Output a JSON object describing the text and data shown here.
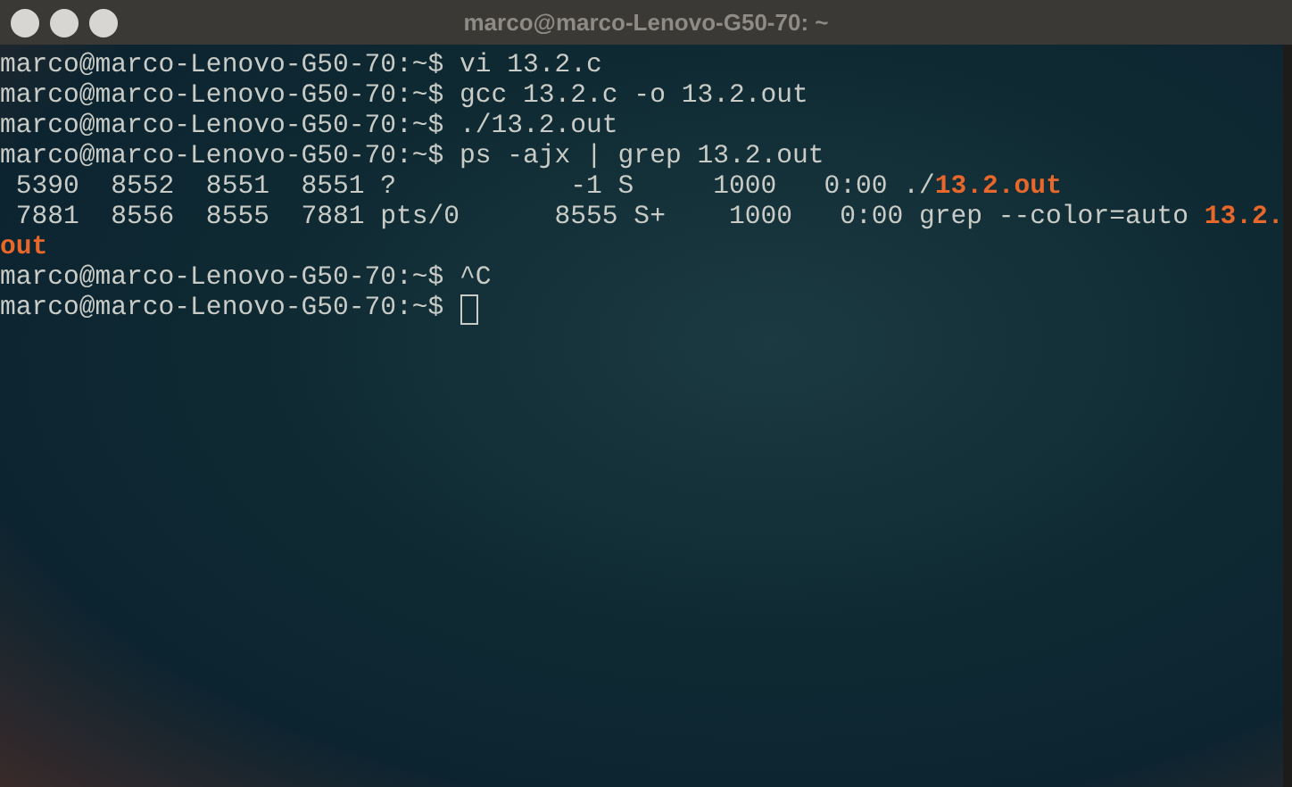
{
  "window": {
    "title": "marco@marco-Lenovo-G50-70: ~"
  },
  "terminal": {
    "cursor": true,
    "lines": [
      {
        "segments": [
          {
            "text": "marco@marco-Lenovo-G50-70:~$ vi 13.2.c",
            "highlight": false
          }
        ]
      },
      {
        "segments": [
          {
            "text": "marco@marco-Lenovo-G50-70:~$ gcc 13.2.c -o 13.2.out",
            "highlight": false
          }
        ]
      },
      {
        "segments": [
          {
            "text": "marco@marco-Lenovo-G50-70:~$ ./13.2.out",
            "highlight": false
          }
        ]
      },
      {
        "segments": [
          {
            "text": "marco@marco-Lenovo-G50-70:~$ ps -ajx | grep 13.2.out",
            "highlight": false
          }
        ]
      },
      {
        "segments": [
          {
            "text": " 5390  8552  8551  8551 ?           -1 S     1000   0:00 ./",
            "highlight": false
          },
          {
            "text": "13.2.out",
            "highlight": true
          }
        ]
      },
      {
        "segments": [
          {
            "text": " 7881  8556  8555  7881 pts/0      8555 S+    1000   0:00 grep --color=auto ",
            "highlight": false
          },
          {
            "text": "13.2.",
            "highlight": true
          }
        ]
      },
      {
        "segments": [
          {
            "text": "out",
            "highlight": true
          }
        ]
      },
      {
        "segments": [
          {
            "text": "marco@marco-Lenovo-G50-70:~$ ^C",
            "highlight": false
          }
        ]
      },
      {
        "segments": [
          {
            "text": "marco@marco-Lenovo-G50-70:~$ ",
            "highlight": false
          }
        ]
      }
    ]
  }
}
